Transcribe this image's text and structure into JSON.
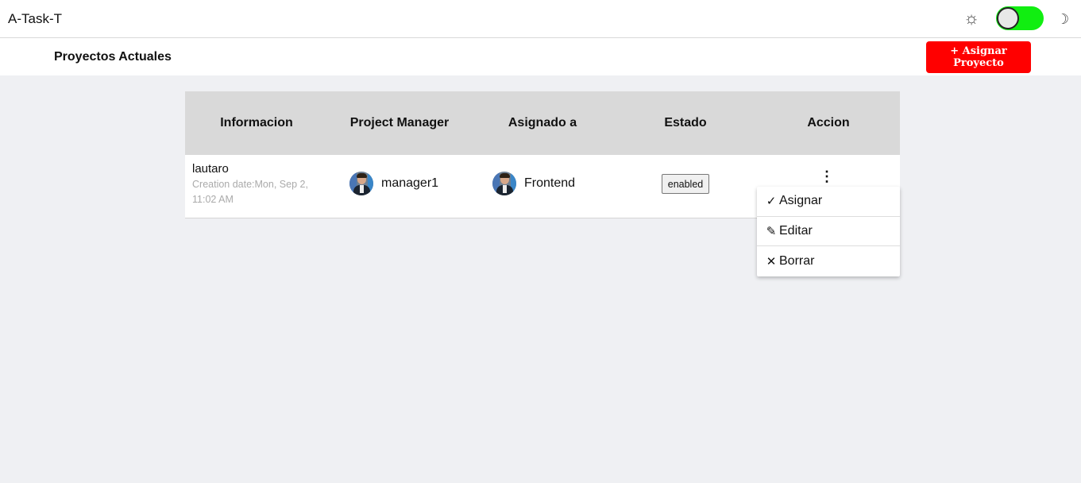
{
  "header": {
    "app_title": "A-Task-T",
    "icons": [
      "sun-icon",
      "theme-toggle",
      "moon-icon"
    ],
    "sun_glyph": "☼",
    "moon_glyph": "☽"
  },
  "subheader": {
    "title": "Proyectos Actuales",
    "assign_button": "+ Asignar Proyecto"
  },
  "table": {
    "columns": [
      "Informacion",
      "Project Manager",
      "Asignado a",
      "Estado",
      "Accion"
    ],
    "rows": [
      {
        "name": "lautaro",
        "date": "Creation date:Mon, Sep 2, 11:02 AM",
        "manager": "manager1",
        "assigned": "Frontend",
        "status": "enabled",
        "action_glyph": "⋮"
      }
    ]
  },
  "action_menu": {
    "items": [
      {
        "label": "Asignar",
        "icon": "check-icon",
        "glyph": "✓"
      },
      {
        "label": "Editar",
        "icon": "pencil-icon",
        "glyph": "✎"
      },
      {
        "label": "Borrar",
        "icon": "close-icon",
        "glyph": "✕"
      }
    ]
  },
  "colors": {
    "accent": "#ff0000",
    "toggle_on": "#11ee11",
    "background": "#eff0f3",
    "header_row": "#d9d9d9"
  }
}
